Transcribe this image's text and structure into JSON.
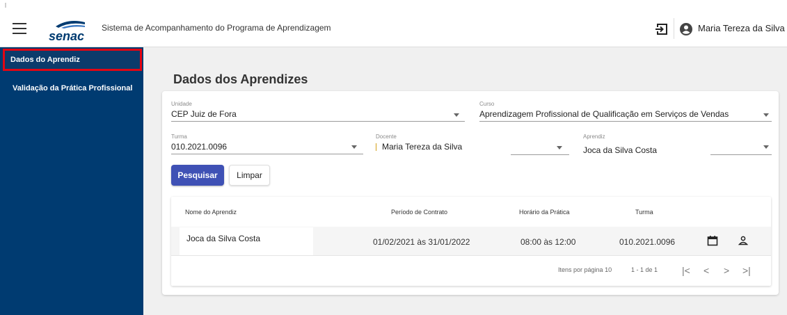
{
  "header": {
    "app_title": "Sistema de Acompanhamento do Programa de Aprendizagem",
    "user_name": "Maria Tereza da Silva",
    "logo_text": "senac",
    "logo_color": "#003b71",
    "icons": [
      "menu-icon",
      "logout-icon",
      "account-circle-icon"
    ]
  },
  "sidebar": {
    "bg_color": "#003b71",
    "items": [
      {
        "label": "Dados do Aprendiz",
        "active": true
      },
      {
        "label": "Validação da Prática Profissional",
        "active": false
      }
    ]
  },
  "main": {
    "title": "Dados dos Aprendizes",
    "filters": {
      "unidade": {
        "label": "Unidade",
        "value": "CEP Juiz de Fora"
      },
      "curso": {
        "label": "Curso",
        "value": "Aprendizagem Profissional de Qualificação em Serviços de Vendas"
      },
      "turma": {
        "label": "Turma",
        "value": "010.2021.0096"
      },
      "docente": {
        "label": "Docente",
        "value": "Maria Tereza da Silva"
      },
      "aprendiz": {
        "label": "Aprendiz",
        "value": "Joca da Silva Costa"
      }
    },
    "buttons": {
      "search": "Pesquisar",
      "clear": "Limpar"
    },
    "table": {
      "columns": [
        "Nome do Aprendiz",
        "Período de Contrato",
        "Horário da Prática",
        "Turma"
      ],
      "rows": [
        {
          "nome": "Joca da Silva Costa",
          "periodo": "01/02/2021 às 31/01/2022",
          "horario": "08:00 às 12:00",
          "turma": "010.2021.0096"
        }
      ],
      "row_icons": [
        "calendar-icon",
        "person-icon"
      ],
      "pagination": {
        "items_label": "Itens por página",
        "items_value": "10",
        "range": "1 - 1 de 1"
      }
    },
    "primary_color": "#3f51b5"
  }
}
